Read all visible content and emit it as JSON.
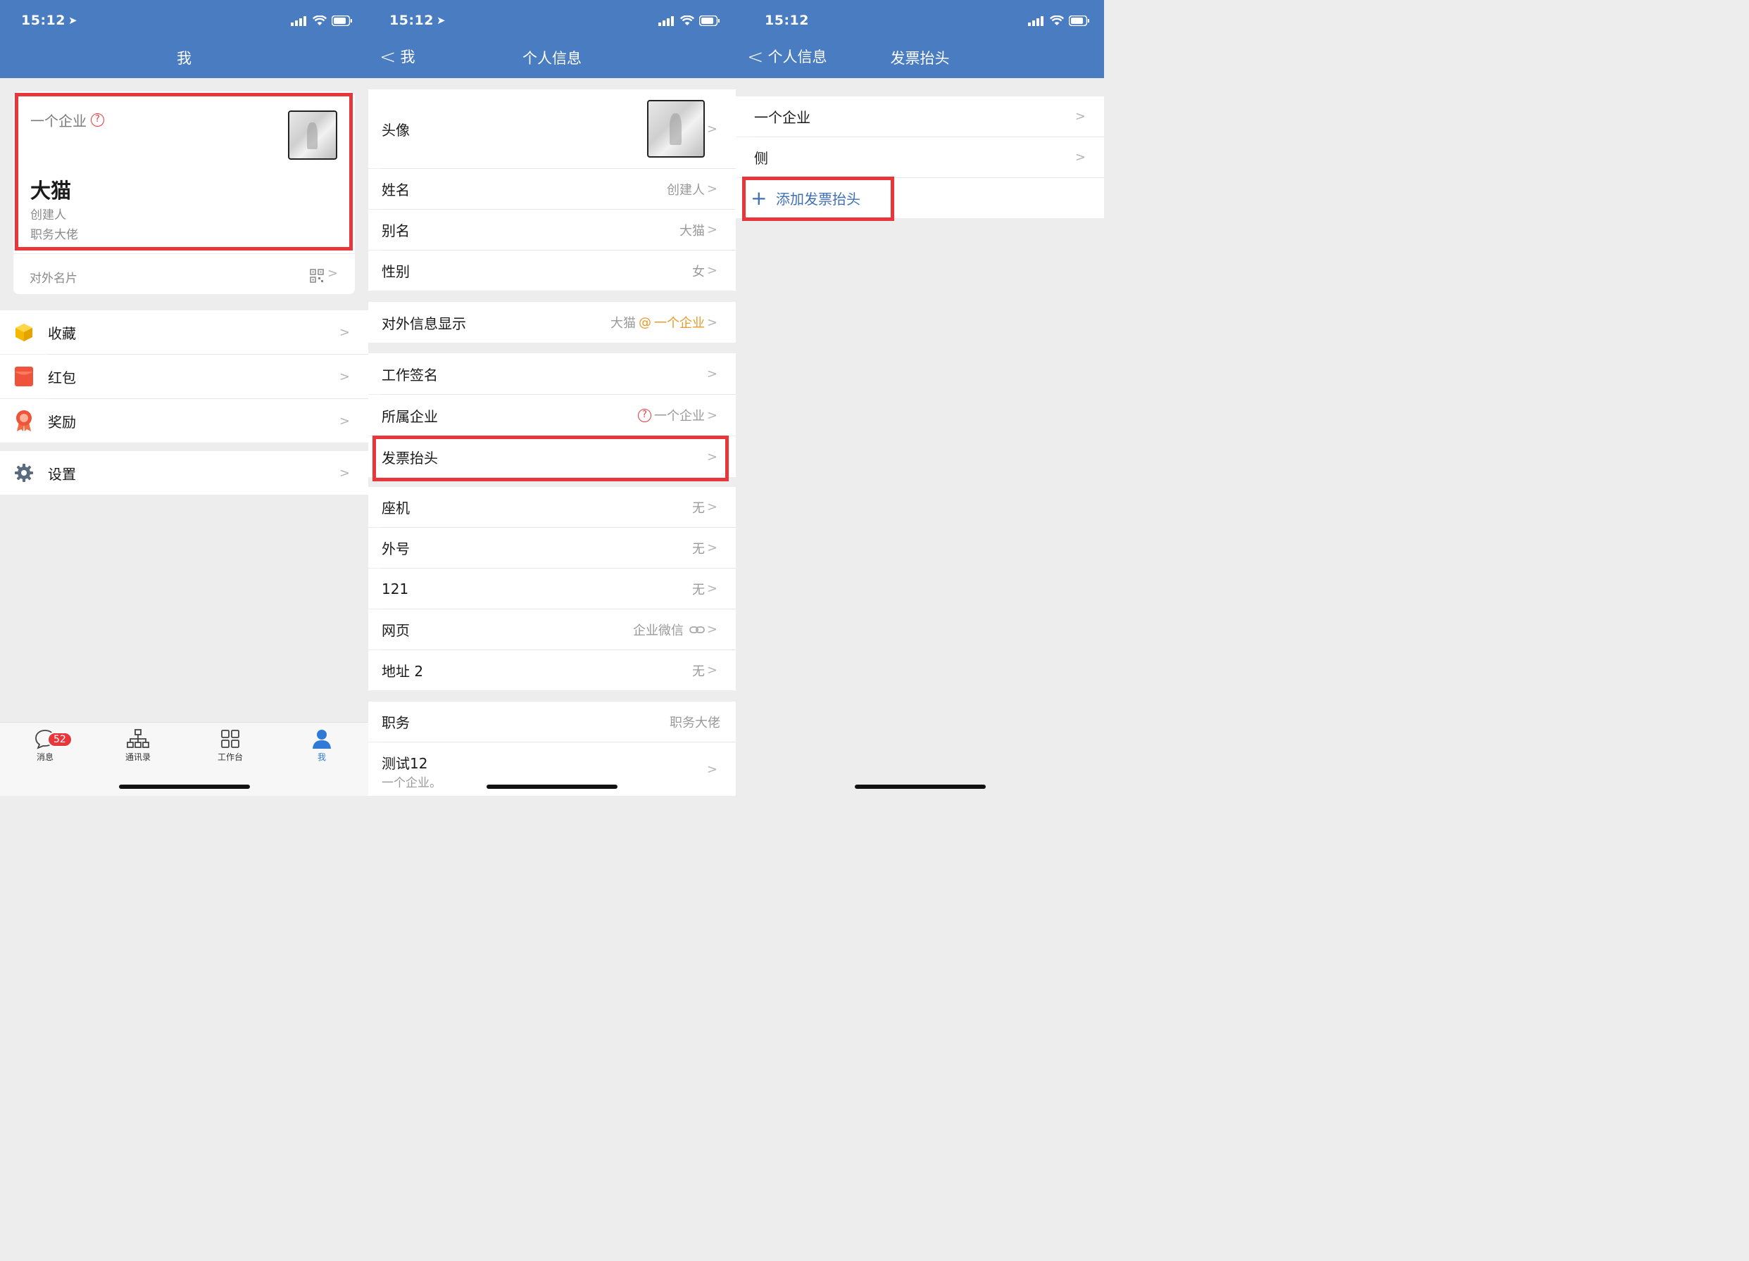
{
  "screen1": {
    "status_time": "15:12",
    "title": "我",
    "card": {
      "company": "一个企业",
      "name": "大猫",
      "role": "创建人",
      "position": "职务大佬",
      "external_card": "对外名片"
    },
    "menu": [
      {
        "label": "收藏",
        "icon": "box-icon"
      },
      {
        "label": "红包",
        "icon": "red-envelope-icon"
      },
      {
        "label": "奖励",
        "icon": "award-ribbon-icon"
      }
    ],
    "settings_label": "设置",
    "tabbar": {
      "messages": "消息",
      "messages_badge": "52",
      "contacts": "通讯录",
      "workbench": "工作台",
      "me": "我"
    }
  },
  "screen2": {
    "status_time": "15:12",
    "back_label": "我",
    "title": "个人信息",
    "avatar_label": "头像",
    "rows1": [
      {
        "label": "姓名",
        "value": "创建人"
      },
      {
        "label": "别名",
        "value": "大猫"
      },
      {
        "label": "性别",
        "value": "女"
      }
    ],
    "external_info": {
      "label": "对外信息显示",
      "value_name": "大猫",
      "value_at": "@",
      "value_company": "一个企业"
    },
    "work_signature": "工作签名",
    "company": {
      "label": "所属企业",
      "value": "一个企业"
    },
    "invoice": "发票抬头",
    "rows2": [
      {
        "label": "座机",
        "value": "无"
      },
      {
        "label": "外号",
        "value": "无"
      },
      {
        "label": "121",
        "value": "无"
      }
    ],
    "webpage": {
      "label": "网页",
      "value": "企业微信"
    },
    "address": {
      "label": "地址 2",
      "value": "无"
    },
    "position": {
      "label": "职务",
      "value": "职务大佬"
    },
    "test": {
      "label": "测试12",
      "sub": "一个企业。"
    }
  },
  "screen3": {
    "status_time": "15:12",
    "back_label": "个人信息",
    "title": "发票抬头",
    "items": [
      "一个企业",
      "侧"
    ],
    "add_label": "添加发票抬头"
  },
  "colors": {
    "nav_blue": "#4a7cc1",
    "highlight_red": "#e8363b",
    "link_blue": "#3f6fb5",
    "orange": "#e89a2b",
    "tab_active": "#2f7ad6"
  }
}
